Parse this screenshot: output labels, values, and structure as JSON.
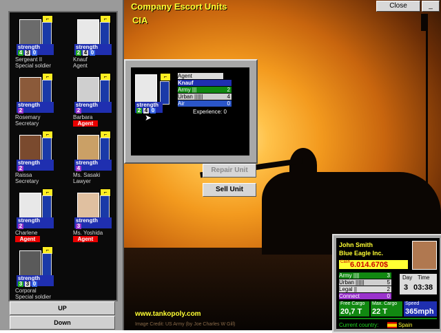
{
  "window": {
    "title": "Company Escort Units",
    "subtitle": "CIA",
    "close_label": "Close",
    "minimize_label": "_"
  },
  "units": [
    {
      "name": "Sergeant II",
      "role": "Special soldier",
      "strength_label": "strength",
      "stats": [
        "4",
        "3",
        "0"
      ],
      "badge": "",
      "portrait_color": "#6b6b6b",
      "icon": "rifle-icon"
    },
    {
      "name": "Knauf",
      "role": "Agent",
      "strength_label": "strength",
      "stats": [
        "2",
        "4",
        "0"
      ],
      "badge": "",
      "portrait_color": "#e8e8e8",
      "icon": "pistol-icon"
    },
    {
      "name": "Rosemary",
      "role": "Secretary",
      "strength_label": "strength",
      "stats": [
        "2"
      ],
      "badge": "",
      "portrait_color": "#8b5a3a",
      "icon": "secretary-icon"
    },
    {
      "name": "Barbara",
      "role": "",
      "strength_label": "strength",
      "stats": [
        "2"
      ],
      "badge": "Agent",
      "portrait_color": "#cfcfcf",
      "icon": "secretary-icon"
    },
    {
      "name": "Raissa",
      "role": "Secretary",
      "strength_label": "strength",
      "stats": [
        "2"
      ],
      "badge": "",
      "portrait_color": "#7a4a2e",
      "icon": "secretary-icon"
    },
    {
      "name": "Ms. Sasaki",
      "role": "Lawyer",
      "strength_label": "strength",
      "stats": [
        "4"
      ],
      "badge": "",
      "portrait_color": "#caa066",
      "icon": "lawyer-icon"
    },
    {
      "name": "Charlene",
      "role": "",
      "strength_label": "strength",
      "stats": [
        "2"
      ],
      "badge": "Agent",
      "portrait_color": "#e8e8e8",
      "icon": "secretary-icon"
    },
    {
      "name": "Ms. Yoshida",
      "role": "",
      "strength_label": "strength",
      "stats": [
        "3"
      ],
      "badge": "Agent",
      "portrait_color": "#e0c0a0",
      "icon": "lawyer-icon"
    },
    {
      "name": "Corporal",
      "role": "Special soldier",
      "strength_label": "strength",
      "stats": [
        "3",
        "3",
        "0"
      ],
      "badge": "",
      "portrait_color": "#5a5a5a",
      "icon": "rifle-icon"
    }
  ],
  "list_controls": {
    "up_label": "UP",
    "down_label": "Down"
  },
  "detail": {
    "role": "Agent",
    "name": "Knauf",
    "strength_label": "strength",
    "stats": [
      "2",
      "4",
      "0"
    ],
    "skills": [
      {
        "label": "Army",
        "bar": "|||",
        "value": "2"
      },
      {
        "label": "Urban",
        "bar": "||||||",
        "value": "4"
      },
      {
        "label": "Air",
        "bar": "",
        "value": "0"
      }
    ],
    "experience_label": "Experience: 0"
  },
  "actions": {
    "repair_label": "Repair Unit",
    "sell_label": "Sell Unit"
  },
  "footer": {
    "website": "www.tankopoly.com",
    "credit": "Image Credit: US Army (by Joe Charles W Gill)"
  },
  "player": {
    "name": "John Smith",
    "company": "Blue Eagle Inc.",
    "cash_label": "Cash",
    "cash": "6.014.670$",
    "strengths": [
      {
        "label": "Army",
        "bar": "||||",
        "value": "3"
      },
      {
        "label": "Urban",
        "bar": "||||||",
        "value": "5"
      },
      {
        "label": "Legal",
        "bar": "||",
        "value": "2"
      },
      {
        "label": "Connect",
        "bar": "",
        "value": "0"
      }
    ],
    "day_label": "Day",
    "day": "3",
    "time_label": "Time",
    "time": "03:38",
    "free_cargo_label": "Free Cargo",
    "free_cargo": "20,7 T",
    "max_cargo_label": "Max. Cargo",
    "max_cargo": "22 T",
    "speed_label": "Speed",
    "speed": "365mph",
    "country_label": "Current country:",
    "country": "Spain"
  }
}
